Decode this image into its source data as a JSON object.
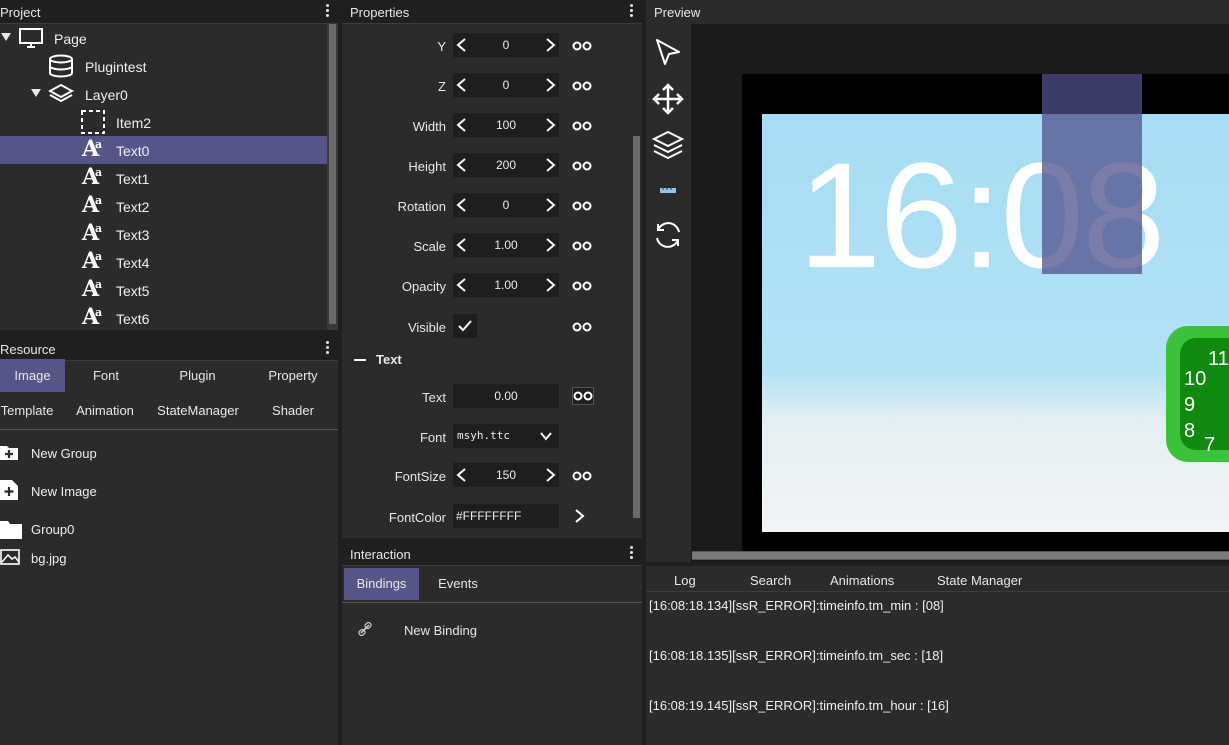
{
  "project": {
    "title": "Project",
    "tree": [
      {
        "label": "Page",
        "icon": "monitor-icon",
        "expanded": true
      },
      {
        "label": "Plugintest",
        "icon": "database-icon"
      },
      {
        "label": "Layer0",
        "icon": "layers-icon",
        "expanded": true
      },
      {
        "label": "Item2",
        "icon": "dashed-box-icon"
      },
      {
        "label": "Text0",
        "icon": "text-icon",
        "selected": true
      },
      {
        "label": "Text1",
        "icon": "text-icon"
      },
      {
        "label": "Text2",
        "icon": "text-icon"
      },
      {
        "label": "Text3",
        "icon": "text-icon"
      },
      {
        "label": "Text4",
        "icon": "text-icon"
      },
      {
        "label": "Text5",
        "icon": "text-icon"
      },
      {
        "label": "Text6",
        "icon": "text-icon"
      }
    ]
  },
  "resource": {
    "title": "Resource",
    "tabs_row1": [
      "Image",
      "Font",
      "Plugin",
      "Property"
    ],
    "tabs_row2": [
      "Template",
      "Animation",
      "StateManager",
      "Shader"
    ],
    "active_tab": "Image",
    "items": [
      {
        "label": "New Group",
        "icon": "add-folder-icon"
      },
      {
        "label": "New Image",
        "icon": "add-file-icon"
      },
      {
        "label": "Group0",
        "icon": "folder-icon"
      },
      {
        "label": "bg.jpg",
        "icon": "image-icon"
      }
    ]
  },
  "properties": {
    "title": "Properties",
    "rows": [
      {
        "label": "Y",
        "value": "0"
      },
      {
        "label": "Z",
        "value": "0"
      },
      {
        "label": "Width",
        "value": "100"
      },
      {
        "label": "Height",
        "value": "200"
      },
      {
        "label": "Rotation",
        "value": "0"
      },
      {
        "label": "Scale",
        "value": "1.00"
      },
      {
        "label": "Opacity",
        "value": "1.00"
      }
    ],
    "visible_label": "Visible",
    "visible_checked": true,
    "text_section": "Text",
    "text_label": "Text",
    "text_value": "0.00",
    "font_label": "Font",
    "font_value": "msyh.ttc",
    "fontsize_label": "FontSize",
    "fontsize_value": "150",
    "fontcolor_label": "FontColor",
    "fontcolor_value": "#FFFFFFFF"
  },
  "interaction": {
    "title": "Interaction",
    "tabs": [
      "Bindings",
      "Events"
    ],
    "active_tab": "Bindings",
    "new_binding": "New Binding"
  },
  "preview": {
    "title": "Preview",
    "clock_text": "16:08",
    "tools": [
      "pointer-icon",
      "move-icon",
      "layers-icon",
      "ruler-icon",
      "refresh-icon"
    ]
  },
  "log": {
    "tabs": [
      "Log",
      "Search",
      "Animations",
      "State Manager"
    ],
    "lines": [
      "[16:08:18.134][ssR_ERROR]:timeinfo.tm_min : [08]",
      "[16:08:18.135][ssR_ERROR]:timeinfo.tm_sec : [18]",
      "[16:08:19.145][ssR_ERROR]:timeinfo.tm_hour : [16]"
    ]
  },
  "colors": {
    "accent": "#555588",
    "panel_bg": "#2b2b2b",
    "header_bg": "#1f1f1f"
  }
}
